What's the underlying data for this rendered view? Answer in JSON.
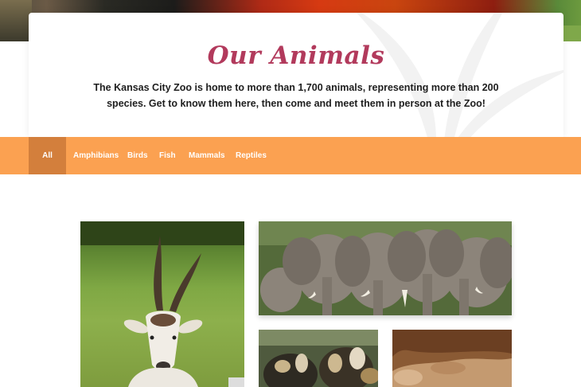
{
  "intro": {
    "title": "Our Animals",
    "description": "The Kansas City Zoo is home to more than 1,700 animals, representing more than 200 species. Get to know them here, then come and meet them in person at the Zoo!"
  },
  "filters": {
    "active": "All",
    "items": [
      {
        "label": "All"
      },
      {
        "label": "Amphibians"
      },
      {
        "label": "Birds"
      },
      {
        "label": "Fish"
      },
      {
        "label": "Mammals"
      },
      {
        "label": "Reptiles"
      }
    ]
  },
  "colors": {
    "title": "#b23a5c",
    "filter_bar": "#fba151",
    "filter_active": "#d37f3c"
  },
  "gallery": {
    "photos": [
      {
        "subject": "addax antelope"
      },
      {
        "subject": "african elephants"
      },
      {
        "subject": "african painted dogs"
      },
      {
        "subject": "rocky enclosure"
      }
    ]
  }
}
